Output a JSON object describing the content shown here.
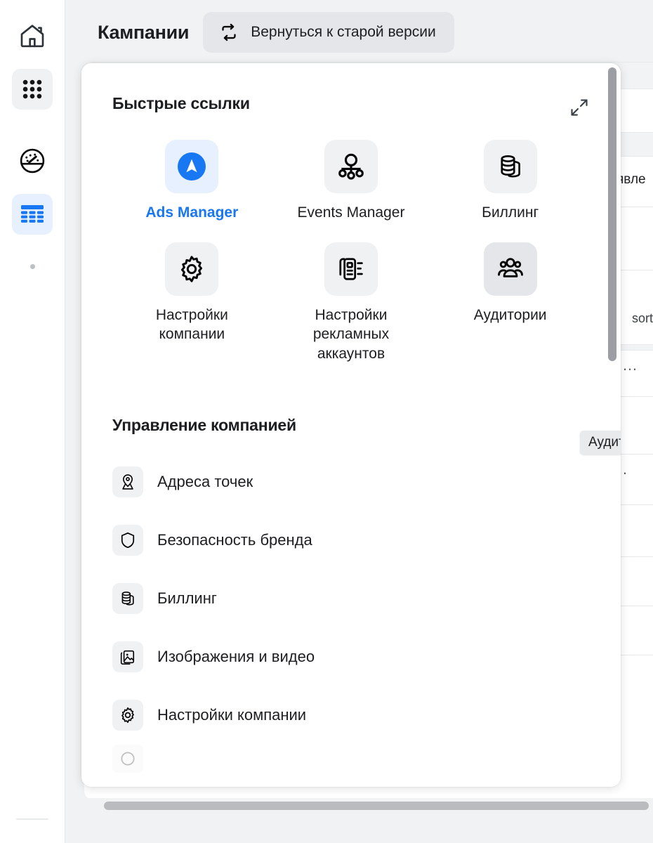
{
  "sidebar": {
    "items": [
      {
        "name": "home",
        "icon": "home-icon",
        "state": "plain"
      },
      {
        "name": "apps",
        "icon": "grid-apps-icon",
        "state": "grey"
      },
      {
        "name": "dashboard",
        "icon": "speedometer-icon",
        "state": "plain"
      },
      {
        "name": "table",
        "icon": "table-icon",
        "state": "blue"
      }
    ],
    "more_indicator": "•"
  },
  "header": {
    "title": "Кампании",
    "legacy_button": {
      "label": "Вернуться к старой версии",
      "icon": "swap-loop-icon"
    }
  },
  "background_table": {
    "column_text": "явле",
    "sort_icon": "sort-updown-icon",
    "overflow_menu": "…"
  },
  "panel": {
    "expand_icon": "expand-diagonal-icon",
    "quick_links": {
      "title": "Быстрые ссылки",
      "items": [
        {
          "label": "Ads Manager",
          "icon": "navigation-arrow-icon",
          "tile": "blue",
          "accent": true
        },
        {
          "label": "Events Manager",
          "icon": "events-graph-icon",
          "tile": "grey",
          "accent": false
        },
        {
          "label": "Биллинг",
          "icon": "coins-stack-icon",
          "tile": "grey",
          "accent": false
        },
        {
          "label": "Настройки компании",
          "icon": "gear-icon",
          "tile": "grey",
          "accent": false
        },
        {
          "label": "Настройки рекламных аккаунтов",
          "icon": "ad-accounts-icon",
          "tile": "grey",
          "accent": false
        },
        {
          "label": "Аудитории",
          "icon": "people-group-icon",
          "tile": "hover",
          "accent": false
        }
      ],
      "tooltip": "Аудитории"
    },
    "management": {
      "title": "Управление компанией",
      "items": [
        {
          "label": "Адреса точек",
          "icon": "map-pin-icon"
        },
        {
          "label": "Безопасность бренда",
          "icon": "shield-icon"
        },
        {
          "label": "Биллинг",
          "icon": "coins-stack-icon"
        },
        {
          "label": "Изображения и видео",
          "icon": "images-video-icon"
        },
        {
          "label": "Настройки компании",
          "icon": "gear-icon"
        }
      ]
    }
  },
  "colors": {
    "accent": "#1877f2",
    "tile_grey": "#f0f1f3",
    "tile_blue": "#e7f0fe",
    "text": "#1c1e21",
    "page_bg": "#f1f2f4"
  }
}
